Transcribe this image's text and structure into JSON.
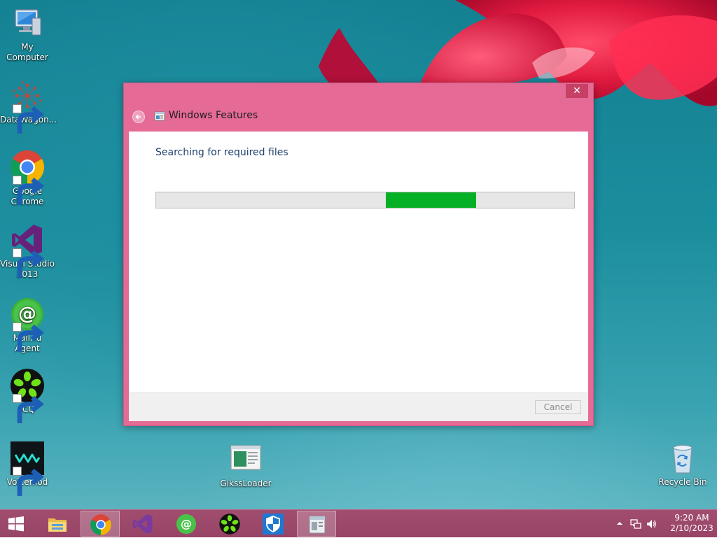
{
  "desktop": {
    "icons": [
      {
        "label": "My Computer",
        "icon": "computer-icon"
      },
      {
        "label": "DataWagon...",
        "icon": "datawagon-icon"
      },
      {
        "label": "Google Chrome",
        "icon": "chrome-icon"
      },
      {
        "label": "Visual Studio 2013",
        "icon": "visual-studio-icon"
      },
      {
        "label": "Mail.ru Agent",
        "icon": "mailru-icon"
      },
      {
        "label": "ICQ",
        "icon": "icq-icon"
      },
      {
        "label": "Voicemod",
        "icon": "voicemod-icon"
      },
      {
        "label": "GikssLoader",
        "icon": "gikssloader-icon"
      },
      {
        "label": "Recycle Bin",
        "icon": "recycle-bin-icon"
      }
    ]
  },
  "dialog": {
    "title": "Windows Features",
    "close_label": "✕",
    "status": "Searching for required files",
    "progress": {
      "fill_start": 0.55,
      "fill_end": 0.765,
      "color": "#06b025"
    },
    "cancel_label": "Cancel"
  },
  "taskbar": {
    "items": [
      {
        "name": "file-explorer",
        "icon": "folder-icon",
        "active": false
      },
      {
        "name": "google-chrome",
        "icon": "chrome-icon",
        "active": true
      },
      {
        "name": "visual-studio",
        "icon": "visual-studio-icon",
        "active": false
      },
      {
        "name": "mailru-agent",
        "icon": "mailru-icon",
        "active": false
      },
      {
        "name": "icq",
        "icon": "icq-icon",
        "active": false
      },
      {
        "name": "windows-defender",
        "icon": "shield-icon",
        "active": false
      },
      {
        "name": "windows-features",
        "icon": "windows-features-icon",
        "active": true
      }
    ],
    "clock": {
      "time": "9:20 AM",
      "date": "2/10/2023"
    }
  },
  "colors": {
    "dialog_frame": "#e56a96",
    "taskbar": "#9c4869",
    "progress_fill": "#06b025"
  }
}
